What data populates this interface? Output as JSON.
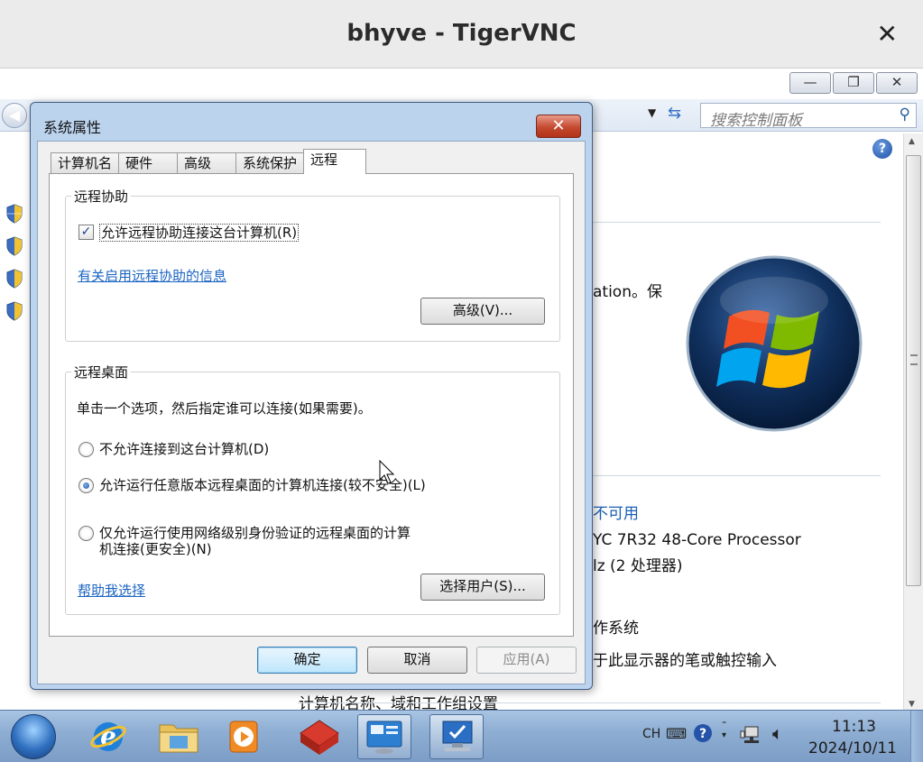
{
  "vnc": {
    "title": "bhyve - TigerVNC",
    "close_glyph": "✕"
  },
  "control_panel": {
    "window_buttons": [
      "—",
      "❐",
      "✕"
    ],
    "search_placeholder": "搜索控制面板",
    "help_glyph": "?",
    "fragments": {
      "activation": "ation。保",
      "unavailable": "不可用",
      "processor": "YC 7R32 48-Core Processor",
      "processor_speed": "lz  (2 处理器)",
      "os_type": "作系统",
      "pen_touch": "于此显示器的笔或触控输入",
      "computer_name_section": "计算机名称、域和工作组设置"
    }
  },
  "dialog": {
    "title": "系统属性",
    "close_glyph": "✕",
    "tabs": [
      "计算机名",
      "硬件",
      "高级",
      "系统保护",
      "远程"
    ],
    "active_tab": 4,
    "remote_assistance": {
      "group_label": "远程协助",
      "checkbox_label": "允许远程协助连接这台计算机(R)",
      "checkbox_checked": true,
      "info_link": "有关启用远程协助的信息",
      "advanced_button": "高级(V)..."
    },
    "remote_desktop": {
      "group_label": "远程桌面",
      "instruction": "单击一个选项，然后指定谁可以连接(如果需要)。",
      "options": [
        "不允许连接到这台计算机(D)",
        "允许运行任意版本远程桌面的计算机连接(较不安全)(L)",
        "仅允许运行使用网络级别身份验证的远程桌面的计算",
        "机连接(更安全)(N)"
      ],
      "selected_option": 1,
      "help_link": "帮助我选择",
      "select_users_button": "选择用户(S)..."
    },
    "buttons": {
      "ok": "确定",
      "cancel": "取消",
      "apply": "应用(A)"
    }
  },
  "taskbar": {
    "language": "CH",
    "time": "11:13",
    "date": "2024/10/11"
  }
}
